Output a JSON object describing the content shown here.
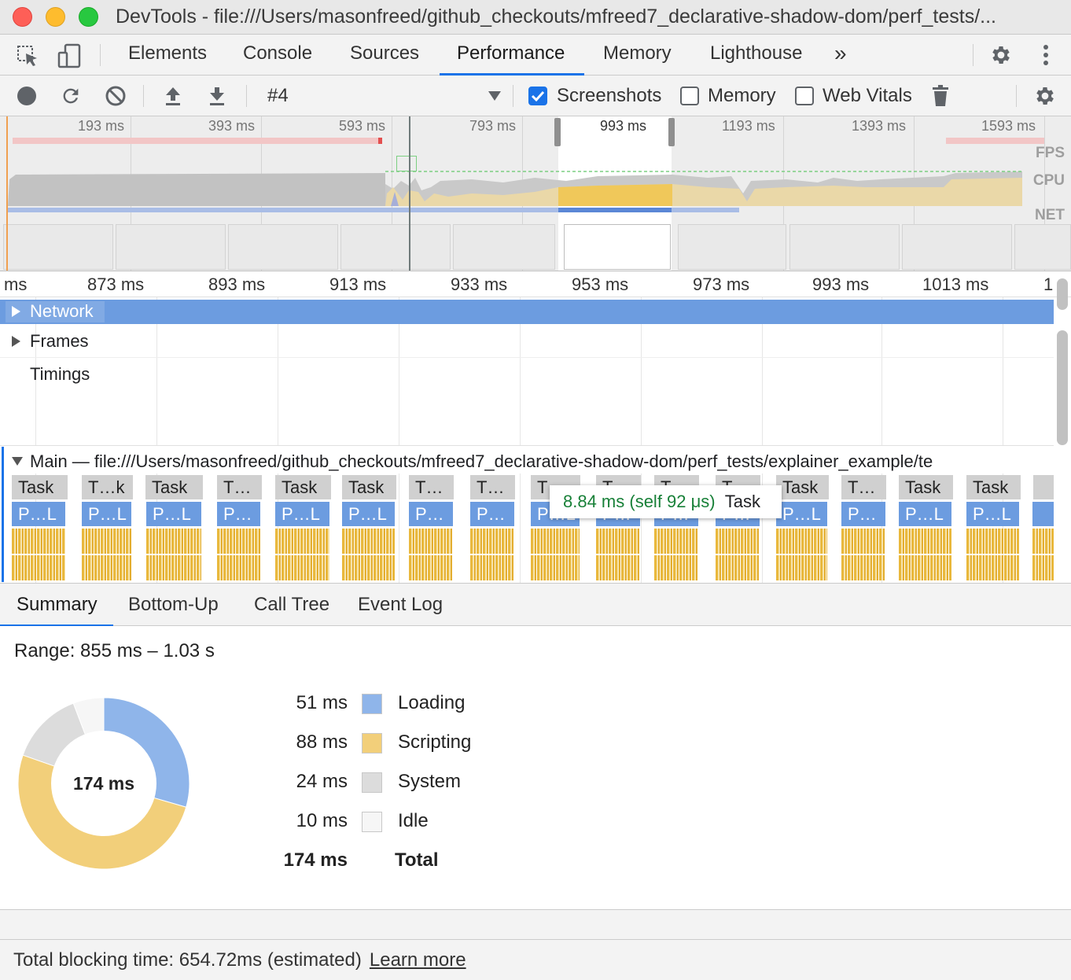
{
  "window": {
    "title": "DevTools - file:///Users/masonfreed/github_checkouts/mfreed7_declarative-shadow-dom/perf_tests/..."
  },
  "tabs": {
    "items": [
      {
        "label": "Elements"
      },
      {
        "label": "Console"
      },
      {
        "label": "Sources"
      },
      {
        "label": "Performance"
      },
      {
        "label": "Memory"
      },
      {
        "label": "Lighthouse"
      }
    ],
    "active": "Performance",
    "overflow_glyph": "»"
  },
  "toolbar": {
    "recording_select": "#4",
    "screenshots_label": "Screenshots",
    "screenshots_checked": true,
    "memory_label": "Memory",
    "memory_checked": false,
    "web_vitals_label": "Web Vitals",
    "web_vitals_checked": false
  },
  "overview": {
    "ticks": [
      "193 ms",
      "393 ms",
      "593 ms",
      "793 ms",
      "993 ms",
      "1193 ms",
      "1393 ms",
      "1593 ms"
    ],
    "fps_label": "FPS",
    "cpu_label": "CPU",
    "net_label": "NET"
  },
  "flame": {
    "ruler": [
      "ms",
      "873 ms",
      "893 ms",
      "913 ms",
      "933 ms",
      "953 ms",
      "973 ms",
      "993 ms",
      "1013 ms",
      "1"
    ],
    "tracks": {
      "network": "Network",
      "frames": "Frames",
      "timings": "Timings",
      "main": "Main — file:///Users/masonfreed/github_checkouts/mfreed7_declarative-shadow-dom/perf_tests/explainer_example/te"
    },
    "tasks": [
      "Task",
      "T…k",
      "Task",
      "T…",
      "Task",
      "Task",
      "T…",
      "T…",
      "T…",
      "T…",
      "T…",
      "T…",
      "Task",
      "T…",
      "Task",
      "Task",
      ""
    ],
    "parse": [
      "P…L",
      "P…L",
      "P…L",
      "P…",
      "P…L",
      "P…L",
      "P…",
      "P…",
      "P…L",
      "P…",
      "P…",
      "P…",
      "P…L",
      "P…",
      "P…L",
      "P…L",
      ""
    ],
    "tooltip": {
      "time": "8.84 ms (self 92 μs)",
      "name": "Task"
    }
  },
  "bottom_tabs": {
    "items": [
      {
        "label": "Summary"
      },
      {
        "label": "Bottom-Up"
      },
      {
        "label": "Call Tree"
      },
      {
        "label": "Event Log"
      }
    ],
    "active": "Summary"
  },
  "summary": {
    "range": "Range: 855 ms – 1.03 s",
    "donut_center": "174 ms",
    "rows": [
      {
        "value": "51 ms",
        "name": "Loading",
        "color": "#8fb5ea"
      },
      {
        "value": "88 ms",
        "name": "Scripting",
        "color": "#f2cf7a"
      },
      {
        "value": "24 ms",
        "name": "System",
        "color": "#dcdcdc"
      },
      {
        "value": "10 ms",
        "name": "Idle",
        "color": "#f6f6f6"
      }
    ],
    "total": {
      "value": "174 ms",
      "name": "Total"
    }
  },
  "status": {
    "text": "Total blocking time: 654.72ms (estimated)",
    "link": "Learn more"
  }
}
